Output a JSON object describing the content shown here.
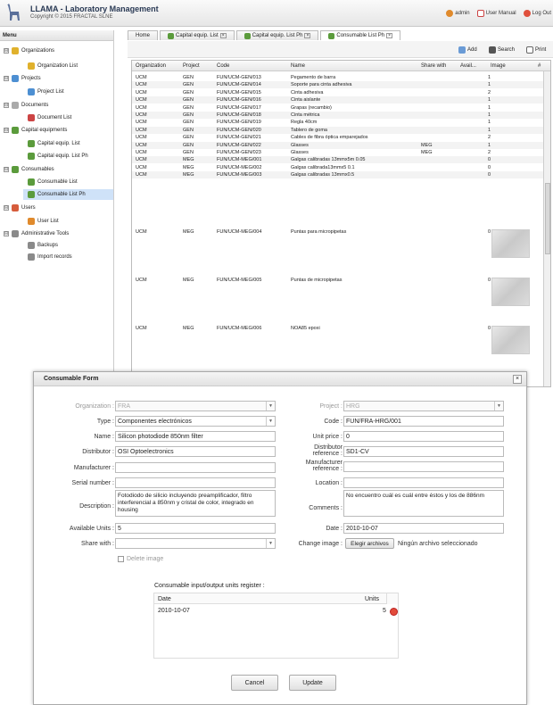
{
  "header": {
    "title": "LLAMA - Laboratory Management",
    "copyright": "Copyright © 2015 FRACTAL SLNE",
    "user": "admin",
    "manual": "User Manual",
    "logout": "Log Out"
  },
  "menu": {
    "title": "Menu",
    "items": [
      {
        "label": "Organizations",
        "expander": "⊟"
      },
      {
        "label": "Organization List"
      },
      {
        "label": "Projects",
        "expander": "⊟"
      },
      {
        "label": "Project List"
      },
      {
        "label": "Documents",
        "expander": "⊟"
      },
      {
        "label": "Document List"
      },
      {
        "label": "Capital equipments",
        "expander": "⊟"
      },
      {
        "label": "Capital equip. List"
      },
      {
        "label": "Capital equip. List Ph"
      },
      {
        "label": "Consumables",
        "expander": "⊟"
      },
      {
        "label": "Consumable List"
      },
      {
        "label": "Consumable List Ph"
      },
      {
        "label": "Users",
        "expander": "⊟"
      },
      {
        "label": "User List"
      },
      {
        "label": "Administrative Tools",
        "expander": "⊟"
      },
      {
        "label": "Backups"
      },
      {
        "label": "Import records"
      }
    ]
  },
  "tabs": [
    "Home",
    "Capital equip. List",
    "Capital equip. List Ph",
    "Consumable List Ph"
  ],
  "toolbar": {
    "add": "Add",
    "search": "Search",
    "print": "Print"
  },
  "grid": {
    "headers": [
      "Organization",
      "Project",
      "Code",
      "Name",
      "Share with",
      "Avail...",
      "Image",
      "#"
    ],
    "rows": [
      [
        "UCM",
        "GEN",
        "FUN/UCM-GEN/013",
        "Pegamento de barra",
        "",
        "1"
      ],
      [
        "UCM",
        "GEN",
        "FUN/UCM-GEN/014",
        "Soporte para cinta adhesiva",
        "",
        "1"
      ],
      [
        "UCM",
        "GEN",
        "FUN/UCM-GEN/015",
        "Cinta adhesiva",
        "",
        "2"
      ],
      [
        "UCM",
        "GEN",
        "FUN/UCM-GEN/016",
        "Cinta aislante",
        "",
        "1"
      ],
      [
        "UCM",
        "GEN",
        "FUN/UCM-GEN/017",
        "Grapas (recambio)",
        "",
        "1"
      ],
      [
        "UCM",
        "GEN",
        "FUN/UCM-GEN/018",
        "Cinta métrica",
        "",
        "1"
      ],
      [
        "UCM",
        "GEN",
        "FUN/UCM-GEN/019",
        "Regla 40cm",
        "",
        "1"
      ],
      [
        "UCM",
        "GEN",
        "FUN/UCM-GEN/020",
        "Tablero de goma",
        "",
        "1"
      ],
      [
        "UCM",
        "GEN",
        "FUN/UCM-GEN/021",
        "Cables de fibra óptica emparejados",
        "",
        "2"
      ],
      [
        "UCM",
        "GEN",
        "FUN/UCM-GEN/022",
        "Glasses",
        "MEG",
        "1"
      ],
      [
        "UCM",
        "GEN",
        "FUN/UCM-GEN/023",
        "Glasses",
        "MEG",
        "2"
      ],
      [
        "UCM",
        "MEG",
        "FUN/UCM-MEG/001",
        "Galgas calibradas 13mmx5m 0.05",
        "",
        "0"
      ],
      [
        "UCM",
        "MEG",
        "FUN/UCM-MEG/002",
        "Galgas calibrada13mmx5 0.1",
        "",
        "0"
      ],
      [
        "UCM",
        "MEG",
        "FUN/UCM-MEG/003",
        "Galgas calibradas 13mmx0.5",
        "",
        "0"
      ]
    ],
    "image_rows": [
      [
        "UCM",
        "MEG",
        "FUN/UCM-MEG/004",
        "Puntas para micropipetas",
        "",
        "0"
      ],
      [
        "UCM",
        "MEG",
        "FUN/UCM-MEG/005",
        "Puntas de micropipetas",
        "",
        "0"
      ],
      [
        "UCM",
        "MEG",
        "FUN/UCM-MEG/006",
        "NOA85 epoxi",
        "",
        "0"
      ]
    ]
  },
  "form": {
    "title": "Consumable Form",
    "organization": {
      "label": "Organization :",
      "value": "FRA"
    },
    "type": {
      "label": "Type :",
      "value": "Componentes electrónicos"
    },
    "name": {
      "label": "Name :",
      "value": "Silicon photodiode 850nm filter"
    },
    "distributor": {
      "label": "Distributor :",
      "value": "OSI Optoelectronics"
    },
    "manufacturer": {
      "label": "Manufacturer :",
      "value": ""
    },
    "serial": {
      "label": "Serial number :",
      "value": ""
    },
    "description": {
      "label": "Description :",
      "value": "Fotodiodo de silicio incluyendo preamplificador, filtro interferencial a 850nm y cristal de color, integrado en housing"
    },
    "units": {
      "label": "Available Units :",
      "value": "5"
    },
    "share": {
      "label": "Share with :",
      "value": ""
    },
    "delete_image": "Delete image",
    "project": {
      "label": "Project :",
      "value": "HRG"
    },
    "code": {
      "label": "Code :",
      "value": "FUN/FRA-HRG/001"
    },
    "unit_price": {
      "label": "Unit price :",
      "value": "0"
    },
    "dist_ref": {
      "label1": "Distributor",
      "label2": "reference :",
      "value": "SD1-CV"
    },
    "manu_ref": {
      "label1": "Manufacturer",
      "label2": "reference :",
      "value": ""
    },
    "location": {
      "label": "Location :",
      "value": ""
    },
    "comments": {
      "label": "Comments :",
      "value": "No encuentro cuál es cuál entre éstos y los de 886nm"
    },
    "date": {
      "label": "Date :",
      "value": "2010-10-07"
    },
    "change_image": {
      "label": "Change image :",
      "button": "Elegir archivos",
      "status": "Ningún archivo seleccionado"
    },
    "register": {
      "title": "Consumable input/output units register :",
      "col_date": "Date",
      "col_units": "Units",
      "rows": [
        {
          "date": "2010-10-07",
          "units": "5"
        }
      ]
    },
    "cancel": "Cancel",
    "update": "Update"
  }
}
